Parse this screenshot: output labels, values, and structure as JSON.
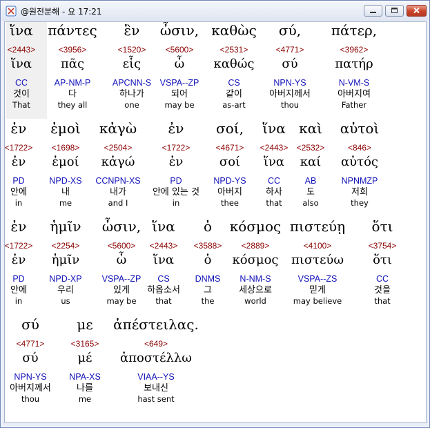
{
  "window": {
    "title": "@원전분해 - 요 17:21"
  },
  "lines": [
    {
      "words": [
        {
          "greek": "ἵνα",
          "strong": "<2443>",
          "lemma": "ἵνα",
          "parsing": "CC",
          "korean": "것이",
          "english": "That"
        },
        {
          "greek": "πάντες",
          "strong": "<3956>",
          "lemma": "πᾶς",
          "parsing": "AP-NM-P",
          "korean": "다",
          "english": "they all"
        },
        {
          "greek": "ἓν",
          "strong": "<1520>",
          "lemma": "εἷς",
          "parsing": "APCNN-S",
          "korean": "하나가",
          "english": "one"
        },
        {
          "greek": "ὦσιν,",
          "strong": "<5600>",
          "lemma": "ὦ",
          "parsing": "VSPA--ZP",
          "korean": "되어",
          "english": "may be"
        },
        {
          "greek": "καθὼς",
          "strong": "<2531>",
          "lemma": "καθώς",
          "parsing": "CS",
          "korean": "같이",
          "english": "as-art"
        },
        {
          "greek": "σύ,",
          "strong": "<4771>",
          "lemma": "σύ",
          "parsing": "NPN-YS",
          "korean": "아버지께서",
          "english": "thou"
        },
        {
          "greek": "πάτερ,",
          "strong": "<3962>",
          "lemma": "πατήρ",
          "parsing": "N-VM-S",
          "korean": "아버지여",
          "english": "Father"
        }
      ]
    },
    {
      "words": [
        {
          "greek": "ἐν",
          "strong": "<1722>",
          "lemma": "ἐν",
          "parsing": "PD",
          "korean": "안에",
          "english": "in"
        },
        {
          "greek": "ἐμοὶ",
          "strong": "<1698>",
          "lemma": "ἐμοί",
          "parsing": "NPD-XS",
          "korean": "내",
          "english": "me"
        },
        {
          "greek": "κἀγὼ",
          "strong": "<2504>",
          "lemma": "κἀγώ",
          "parsing": "CCNPN-XS",
          "korean": "내가",
          "english": "and I"
        },
        {
          "greek": "ἐν",
          "strong": "<1722>",
          "lemma": "ἐν",
          "parsing": "PD",
          "korean": "안에 있는 것",
          "english": "in"
        },
        {
          "greek": "σοί,",
          "strong": "<4671>",
          "lemma": "σοί",
          "parsing": "NPD-YS",
          "korean": "아버지",
          "english": "thee"
        },
        {
          "greek": "ἵνα",
          "strong": "<2443>",
          "lemma": "ἵνα",
          "parsing": "CC",
          "korean": "하사",
          "english": "that"
        },
        {
          "greek": "καὶ",
          "strong": "<2532>",
          "lemma": "καί",
          "parsing": "AB",
          "korean": "도",
          "english": "also"
        },
        {
          "greek": "αὐτοὶ",
          "strong": "<846>",
          "lemma": "αὐτός",
          "parsing": "NPNMZP",
          "korean": "저희",
          "english": "they"
        }
      ]
    },
    {
      "words": [
        {
          "greek": "ἐν",
          "strong": "<1722>",
          "lemma": "ἐν",
          "parsing": "PD",
          "korean": "안에",
          "english": "in"
        },
        {
          "greek": "ἡμῖν",
          "strong": "<2254>",
          "lemma": "ἡμῖν",
          "parsing": "NPD-XP",
          "korean": "우리",
          "english": "us"
        },
        {
          "greek": "ὦσιν,",
          "strong": "<5600>",
          "lemma": "ὦ",
          "parsing": "VSPA--ZP",
          "korean": "있게",
          "english": "may be"
        },
        {
          "greek": "ἵνα",
          "strong": "<2443>",
          "lemma": "ἵνα",
          "parsing": "CS",
          "korean": "하옵소서",
          "english": "that"
        },
        {
          "greek": "ὁ",
          "strong": "<3588>",
          "lemma": "ὁ",
          "parsing": "DNMS",
          "korean": "그",
          "english": "the"
        },
        {
          "greek": "κόσμος",
          "strong": "<2889>",
          "lemma": "κόσμος",
          "parsing": "N-NM-S",
          "korean": "세상으로",
          "english": "world"
        },
        {
          "greek": "πιστεύῃ",
          "strong": "<4100>",
          "lemma": "πιστεύω",
          "parsing": "VSPA--ZS",
          "korean": "믿게",
          "english": "may believe"
        },
        {
          "greek": "ὅτι",
          "strong": "<3754>",
          "lemma": "ὅτι",
          "parsing": "CC",
          "korean": "것을",
          "english": "that"
        }
      ]
    },
    {
      "words": [
        {
          "greek": "σύ",
          "strong": "<4771>",
          "lemma": "σύ",
          "parsing": "NPN-YS",
          "korean": "아버지께서",
          "english": "thou"
        },
        {
          "greek": "με",
          "strong": "<3165>",
          "lemma": "μέ",
          "parsing": "NPA-XS",
          "korean": "나를",
          "english": "me"
        },
        {
          "greek": "ἀπέστειλας.",
          "strong": "<649>",
          "lemma": "ἀποστέλλω",
          "parsing": "VIAA--YS",
          "korean": "보내신",
          "english": "hast sent"
        }
      ]
    }
  ]
}
